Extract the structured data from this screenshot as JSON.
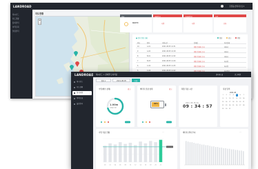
{
  "back_window": {
    "logo": "LANDROAD",
    "page_title": "지도현황",
    "user_label": "홍길동(관리자) 님 ▾",
    "nav_items": [
      "대시보드",
      "지도현황",
      "장치관리",
      "이력조회",
      "설정관리"
    ],
    "map_zoom": [
      "+",
      "−"
    ],
    "weather_panels": [
      {
        "title": "날씨",
        "value": "10.8°C"
      },
      {
        "title": "미세먼지",
        "value": "나쁨"
      },
      {
        "title": "초미세먼지",
        "value": "나쁨"
      },
      {
        "title": "오존",
        "value": "보통"
      }
    ],
    "table_title": "● 장치 알람 현황",
    "legend": [
      "정상",
      "경고",
      "위험"
    ],
    "table_headers": [
      "번호",
      "장치",
      "측정시간",
      "상태값",
      "처리상태"
    ],
    "table_rows": [
      [
        "10",
        "A-01",
        "2021.08.05 12:31",
        "위험 임계치 초과",
        "미처리"
      ],
      [
        "9",
        "A-02",
        "2021.08.05 12:18",
        "위험 임계치 초과",
        "미처리"
      ],
      [
        "8",
        "B-01",
        "2021.08.05 11:52",
        "위험 임계치 초과",
        "미처리"
      ],
      [
        "7",
        "B-03",
        "2021.08.05 11:40",
        "위험 임계치 초과",
        "처리중"
      ],
      [
        "6",
        "C-02",
        "2021.08.05 11:25",
        "위험 임계치 초과",
        "처리중"
      ],
      [
        "5",
        "C-04",
        "2021.08.05 11:02",
        "위험 임계치 초과",
        "처리완료"
      ],
      [
        "4",
        "D-01",
        "2021.08.05 10:47",
        "위험 임계치 초과",
        "처리완료"
      ]
    ],
    "colors": {
      "dark": "#22262e",
      "alert": "#e04848"
    }
  },
  "front_window": {
    "logo": "LANDROAD",
    "breadcrumb": "대시보드 > 장치별 모니터링",
    "user_label": "관리자 님",
    "logout_label": "로그아웃",
    "nav_items": [
      {
        "label": "대시보드",
        "active": false
      },
      {
        "label": "지도현황",
        "active": false
      },
      {
        "label": "모니터링",
        "active": true
      },
      {
        "label": "이력조회",
        "active": false
      },
      {
        "label": "설정관리",
        "active": false
      }
    ],
    "toolbar": {
      "device_select": "장치 ▾",
      "date": "2021-08-05",
      "search_label": "조회"
    },
    "cards": {
      "gauge": {
        "title": "수위(배수 상태)",
        "badge": "경고",
        "value": "1.00m",
        "sub": "측정값 기준",
        "percent": 70
      },
      "battery": {
        "title": "배터리 잔량 상태",
        "badge": "경고",
        "value": "60%",
        "percent": 60
      },
      "clock": {
        "title": "최종 측정 시간",
        "date": "2021. 08. 05 (목)",
        "time": "09 : 34 : 57"
      },
      "calendar": {
        "title": "측정 달력",
        "month": "2021.08",
        "today": 5
      },
      "bar_chart": {
        "title": "수위 측정 현황"
      },
      "bar_chart2": {
        "title": "배터리 변화 추이"
      }
    },
    "chart_left": {
      "values": [
        28,
        32,
        30,
        34,
        31,
        33,
        29,
        35,
        32,
        36,
        34,
        38
      ],
      "highlight_index": 11,
      "threshold": 26,
      "xlabels": [
        "00",
        "02",
        "04",
        "06",
        "08",
        "10",
        "12",
        "14",
        "16",
        "18",
        "20",
        "22"
      ]
    },
    "chart_right": {
      "values": [
        40,
        39,
        38,
        38,
        37,
        36,
        36,
        35,
        34,
        34,
        33,
        33,
        32,
        31,
        31,
        30,
        30,
        29,
        29,
        28,
        28,
        27,
        27,
        26,
        26,
        25,
        25,
        24,
        24,
        23
      ]
    },
    "colors": {
      "accent": "#27b4a8",
      "battery": "#f0b441",
      "today": "#1e86d0",
      "highlight": "#2ecc9a"
    }
  }
}
